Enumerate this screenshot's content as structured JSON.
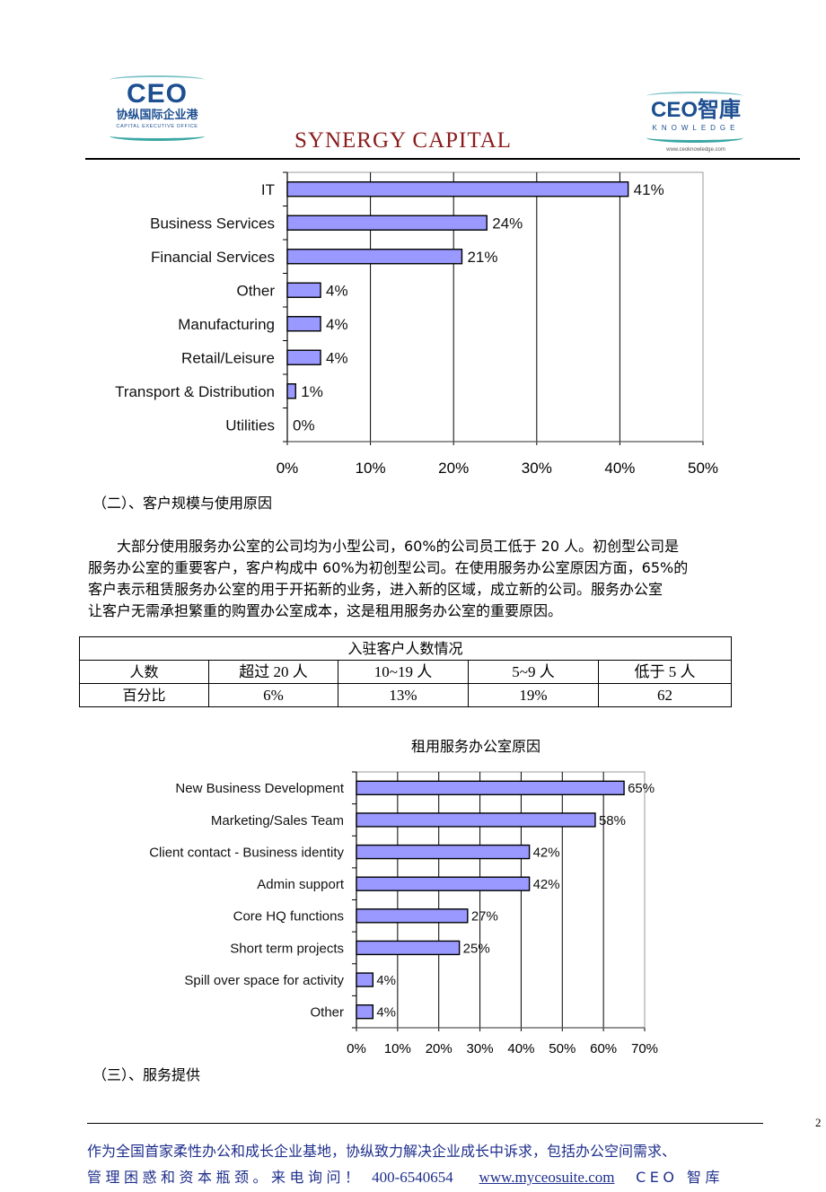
{
  "header": {
    "left_logo": {
      "mark": "CEO",
      "chinese_name": "协纵国际企业港",
      "english_name": "CAPITAL EXECUTIVE OFFICE"
    },
    "center_logo": {
      "text": "SYNERGY CAPITAL"
    },
    "right_logo": {
      "mark": "CEO智庫",
      "subtitle": "KNOWLEDGE",
      "url": "www.ceoknowledge.com"
    }
  },
  "colors": {
    "bar_fill": "#9999ff",
    "bar_stroke": "#000000",
    "footer_text": "#1f2f8c",
    "synergy_red": "#8b1c1c",
    "logo_blue": "#1d4f91"
  },
  "section2": {
    "heading": "（二）、客户规模与使用原因"
  },
  "paragraph": {
    "lines": [
      "　　大部分使用服务办公室的公司均为小型公司，60%的公司员工低于 20 人。初创型公司是",
      "服务办公室的重要客户，客户构成中 60%为初创型公司。在使用服务办公室原因方面，65%的",
      "客户表示租赁服务办公室的用于开拓新的业务，进入新的区域，成立新的公司。服务办公室",
      "让客户无需承担繁重的购置办公室成本，这是租用服务办公室的重要原因。"
    ]
  },
  "table": {
    "title": "入驻客户人数情况",
    "header_row": [
      "人数",
      "超过 20 人",
      "10~19 人",
      "5~9 人",
      "低于 5 人"
    ],
    "value_row": [
      "百分比",
      "6%",
      "13%",
      "19%",
      "62"
    ]
  },
  "section3": {
    "heading": "（三）、服务提供"
  },
  "footer": {
    "page_number": "2",
    "line1": "作为全国首家柔性办公和成长企业基地，协纵致力解决企业成长中诉求，包括办公空间需求、",
    "line2_prefix": "管理困惑和资本瓶颈。来电询问！",
    "phone": "400-6540654",
    "website": "www.myceosuite.com",
    "line2_suffix": "CEO 智库"
  },
  "chart_data": [
    {
      "type": "bar",
      "orientation": "horizontal",
      "title": "",
      "categories": [
        "IT",
        "Business Services",
        "Financial Services",
        "Other",
        "Manufacturing",
        "Retail/Leisure",
        "Transport & Distribution",
        "Utilities"
      ],
      "values": [
        41,
        24,
        21,
        4,
        4,
        4,
        1,
        0
      ],
      "data_labels": [
        "41%",
        "24%",
        "21%",
        "4%",
        "4%",
        "4%",
        "1%",
        "0%"
      ],
      "xlim": [
        0,
        50
      ],
      "xticks": [
        "0%",
        "10%",
        "20%",
        "30%",
        "40%",
        "50%"
      ],
      "xtick_values": [
        0,
        10,
        20,
        30,
        40,
        50
      ],
      "grid": true,
      "xlabel": "",
      "ylabel": ""
    },
    {
      "type": "bar",
      "orientation": "horizontal",
      "title": "租用服务办公室原因",
      "categories": [
        "New Business Development",
        "Marketing/Sales Team",
        "Client contact - Business identity",
        "Admin support",
        "Core HQ functions",
        "Short term projects",
        "Spill over space for activity",
        "Other"
      ],
      "values": [
        65,
        58,
        42,
        42,
        27,
        25,
        4,
        4
      ],
      "data_labels": [
        "65%",
        "58%",
        "42%",
        "42%",
        "27%",
        "25%",
        "4%",
        "4%"
      ],
      "xlim": [
        0,
        70
      ],
      "xticks": [
        "0%",
        "10%",
        "20%",
        "30%",
        "40%",
        "50%",
        "60%",
        "70%"
      ],
      "xtick_values": [
        0,
        10,
        20,
        30,
        40,
        50,
        60,
        70
      ],
      "grid": true,
      "xlabel": "",
      "ylabel": ""
    }
  ]
}
